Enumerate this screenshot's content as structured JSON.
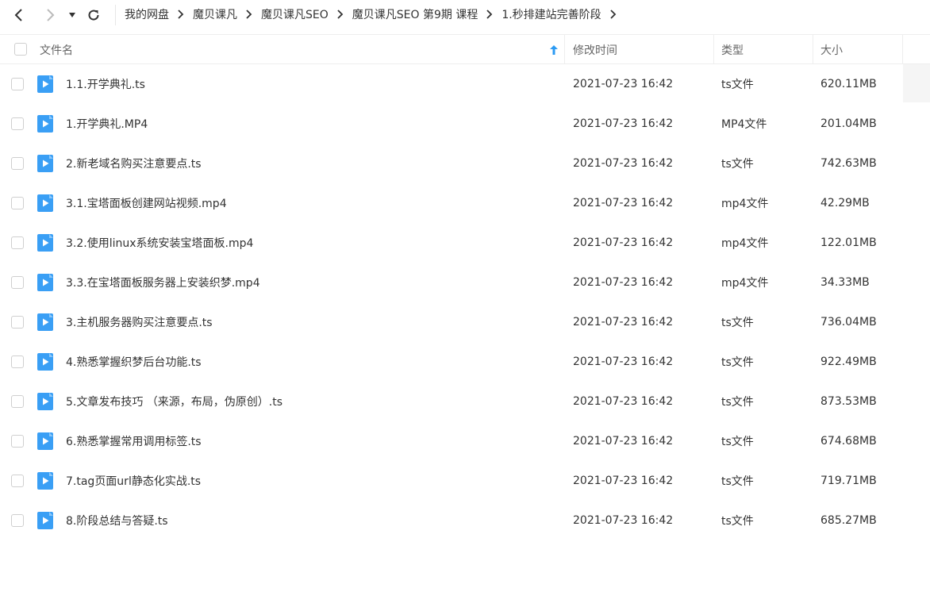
{
  "nav": {
    "breadcrumb": [
      "我的网盘",
      "魔贝课凡",
      "魔贝课凡SEO",
      "魔贝课凡SEO 第9期 课程",
      "1.秒排建站完善阶段"
    ]
  },
  "table": {
    "headers": {
      "name": "文件名",
      "modified": "修改时间",
      "type": "类型",
      "size": "大小"
    },
    "rows": [
      {
        "name": "1.1.开学典礼.ts",
        "modified": "2021-07-23 16:42",
        "type": "ts文件",
        "size": "620.11MB"
      },
      {
        "name": "1.开学典礼.MP4",
        "modified": "2021-07-23 16:42",
        "type": "MP4文件",
        "size": "201.04MB"
      },
      {
        "name": "2.新老域名购买注意要点.ts",
        "modified": "2021-07-23 16:42",
        "type": "ts文件",
        "size": "742.63MB"
      },
      {
        "name": "3.1.宝塔面板创建网站视频.mp4",
        "modified": "2021-07-23 16:42",
        "type": "mp4文件",
        "size": "42.29MB"
      },
      {
        "name": "3.2.使用linux系统安装宝塔面板.mp4",
        "modified": "2021-07-23 16:42",
        "type": "mp4文件",
        "size": "122.01MB"
      },
      {
        "name": "3.3.在宝塔面板服务器上安装织梦.mp4",
        "modified": "2021-07-23 16:42",
        "type": "mp4文件",
        "size": "34.33MB"
      },
      {
        "name": "3.主机服务器购买注意要点.ts",
        "modified": "2021-07-23 16:42",
        "type": "ts文件",
        "size": "736.04MB"
      },
      {
        "name": "4.熟悉掌握织梦后台功能.ts",
        "modified": "2021-07-23 16:42",
        "type": "ts文件",
        "size": "922.49MB"
      },
      {
        "name": "5.文章发布技巧 （来源，布局，伪原创）.ts",
        "modified": "2021-07-23 16:42",
        "type": "ts文件",
        "size": "873.53MB"
      },
      {
        "name": "6.熟悉掌握常用调用标签.ts",
        "modified": "2021-07-23 16:42",
        "type": "ts文件",
        "size": "674.68MB"
      },
      {
        "name": "7.tag页面url静态化实战.ts",
        "modified": "2021-07-23 16:42",
        "type": "ts文件",
        "size": "719.71MB"
      },
      {
        "name": "8.阶段总结与答疑.ts",
        "modified": "2021-07-23 16:42",
        "type": "ts文件",
        "size": "685.27MB"
      }
    ]
  },
  "colors": {
    "accent": "#2b9af3",
    "file_icon": "#3a9ff5"
  }
}
